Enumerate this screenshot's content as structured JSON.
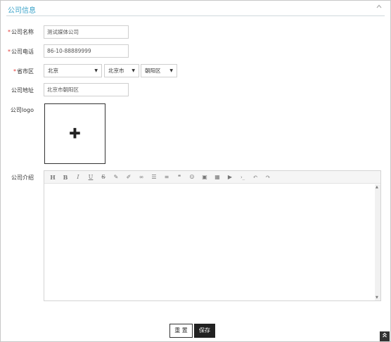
{
  "panel": {
    "title": "公司信息",
    "collapse_icon": "chevron-up-icon"
  },
  "form": {
    "required_mark": "*",
    "company_name": {
      "label": "公司名称",
      "value": "测试媒体公司"
    },
    "company_phone": {
      "label": "公司电话",
      "value": "86-10-88889999"
    },
    "region": {
      "label": "省市区",
      "province": "北京",
      "city": "北京市",
      "district": "朝阳区",
      "arrow": "▼"
    },
    "company_address": {
      "label": "公司地址",
      "value": "北京市朝阳区"
    },
    "company_logo": {
      "label": "公司logo",
      "upload_glyph": "✚"
    },
    "company_intro": {
      "label": "公司介绍"
    }
  },
  "editor_toolbar": {
    "heading": "H",
    "bold": "B",
    "italic": "I",
    "underline": "U",
    "strikethrough": "S",
    "eraser": "✎",
    "brush": "✐",
    "link": "∞",
    "unordered_list": "☰",
    "ordered_list": "≡",
    "quote": "❝",
    "emoji": "☺",
    "image": "▣",
    "table": "▦",
    "video": "▶",
    "code": "›_",
    "undo": "↶",
    "redo": "↷"
  },
  "scroll": {
    "up": "▲",
    "down": "▼"
  },
  "actions": {
    "reset_label": "重 置",
    "save_label": "保存"
  },
  "back_to_top": {
    "icon": "double-chevron-up-icon",
    "glyph": "»"
  }
}
